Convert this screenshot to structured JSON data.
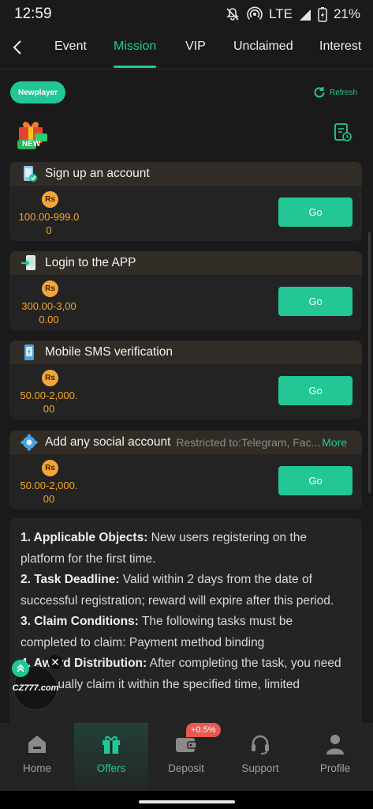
{
  "status_bar": {
    "time": "12:59",
    "network": "LTE",
    "battery": "21%",
    "icons": [
      "mute-icon",
      "hotspot-icon",
      "signal-icon",
      "battery-icon"
    ]
  },
  "tabs": [
    {
      "label": "Event"
    },
    {
      "label": "Mission"
    },
    {
      "label": "VIP"
    },
    {
      "label": "Unclaimed"
    },
    {
      "label": "Interest"
    }
  ],
  "active_tab": "Mission",
  "header": {
    "badge": "Newplayer",
    "refresh": "Refresh",
    "gift_badge": "NEW"
  },
  "tasks": [
    {
      "title": "Sign up an account",
      "currency": "Rs",
      "reward": "100.00-999.00",
      "button": "Go",
      "restriction": "",
      "more": ""
    },
    {
      "title": "Login to the APP",
      "currency": "Rs",
      "reward": "300.00-3,000.00",
      "button": "Go",
      "restriction": "",
      "more": ""
    },
    {
      "title": "Mobile SMS verification",
      "currency": "Rs",
      "reward": "50.00-2,000.00",
      "button": "Go",
      "restriction": "",
      "more": ""
    },
    {
      "title": "Add any social account",
      "currency": "Rs",
      "reward": "50.00-2,000.00",
      "button": "Go",
      "restriction": "Restricted to:Telegram, Fac...",
      "more": "More"
    }
  ],
  "rules": [
    {
      "head": "1. Applicable Objects:",
      "text": " New users registering on the platform for the first time."
    },
    {
      "head": "2. Task Deadline:",
      "text": " Valid within 2 days from the date of successful registration; reward will expire after this period."
    },
    {
      "head": "3. Claim Conditions:",
      "text": " The following tasks must be completed to claim: Payment method binding"
    },
    {
      "head": "4. Award Distribution:",
      "text": " After completing the task, you need to manually claim it within the specified time, limited"
    }
  ],
  "floating": {
    "logo_text": "CZ777.com"
  },
  "bottom_nav": [
    {
      "label": "Home",
      "icon": "home-icon"
    },
    {
      "label": "Offers",
      "icon": "gift-icon"
    },
    {
      "label": "Deposit",
      "icon": "wallet-icon"
    },
    {
      "label": "Support",
      "icon": "headset-icon"
    },
    {
      "label": "Profile",
      "icon": "profile-icon"
    }
  ],
  "deposit_badge": "+0.5%",
  "colors": {
    "accent": "#22c795",
    "reward": "#f5a623",
    "background": "#1a1a1a",
    "badge": "#e85a4f"
  }
}
